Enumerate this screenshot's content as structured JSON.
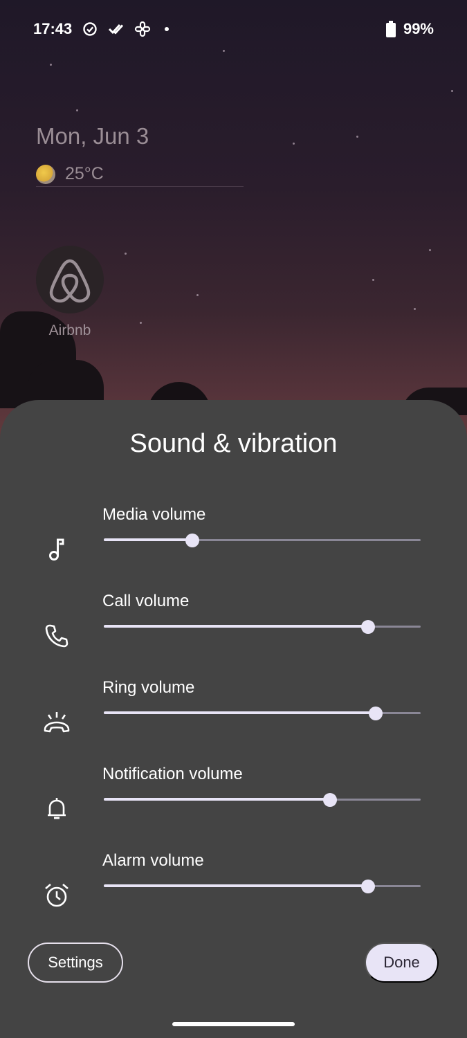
{
  "status_bar": {
    "time": "17:43",
    "icons": [
      "check-circle-icon",
      "double-check-icon",
      "pinwheel-icon",
      "dot-icon"
    ],
    "battery_icon": "battery-icon",
    "battery": "99%"
  },
  "home": {
    "date": "Mon, Jun 3",
    "weather_icon": "partly-sunny-icon",
    "temperature": "25°C",
    "app": {
      "label": "Airbnb",
      "icon": "airbnb-icon"
    }
  },
  "sheet": {
    "title": "Sound & vibration",
    "accent_color": "#e8e4f6",
    "sliders": [
      {
        "label": "Media volume",
        "icon": "music-note-icon",
        "level": 0.28
      },
      {
        "label": "Call volume",
        "icon": "phone-icon",
        "level": 0.835
      },
      {
        "label": "Ring volume",
        "icon": "ring-icon",
        "level": 0.857
      },
      {
        "label": "Notification volume",
        "icon": "bell-icon",
        "level": 0.715
      },
      {
        "label": "Alarm volume",
        "icon": "alarm-clock-icon",
        "level": 0.835
      }
    ],
    "settings_label": "Settings",
    "done_label": "Done"
  }
}
